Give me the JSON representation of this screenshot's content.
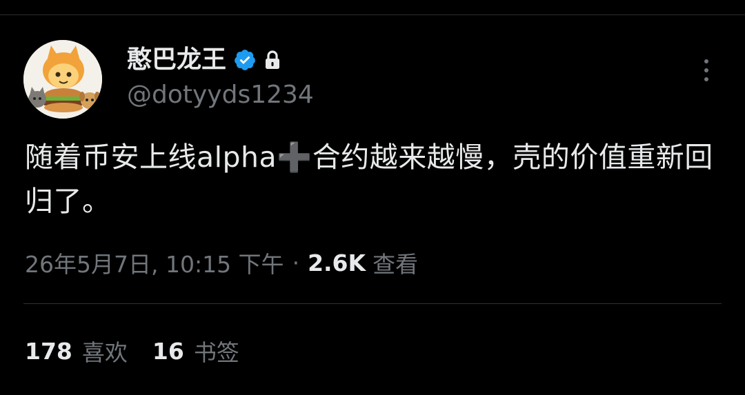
{
  "colors": {
    "background": "#000000",
    "text_primary": "#e7e9ea",
    "text_secondary": "#71767b",
    "verified_blue": "#1d9bf0",
    "divider": "#2f3336"
  },
  "author": {
    "display_name": "憨巴龙王",
    "handle": "@dotyyds1234",
    "avatar_icon": "cartoon-cat-burger-avatar",
    "badges": [
      "verified-badge-icon",
      "lock-icon"
    ]
  },
  "tweet": {
    "text": "随着币安上线alpha➕合约越来越慢，壳的价值重新回归了。"
  },
  "meta": {
    "timestamp": "26年5月7日, 10:15 下午",
    "separator": "·",
    "views_count": "2.6K",
    "views_label": "查看"
  },
  "stats": [
    {
      "count": "178",
      "label": "喜欢"
    },
    {
      "count": "16",
      "label": "书签"
    }
  ]
}
